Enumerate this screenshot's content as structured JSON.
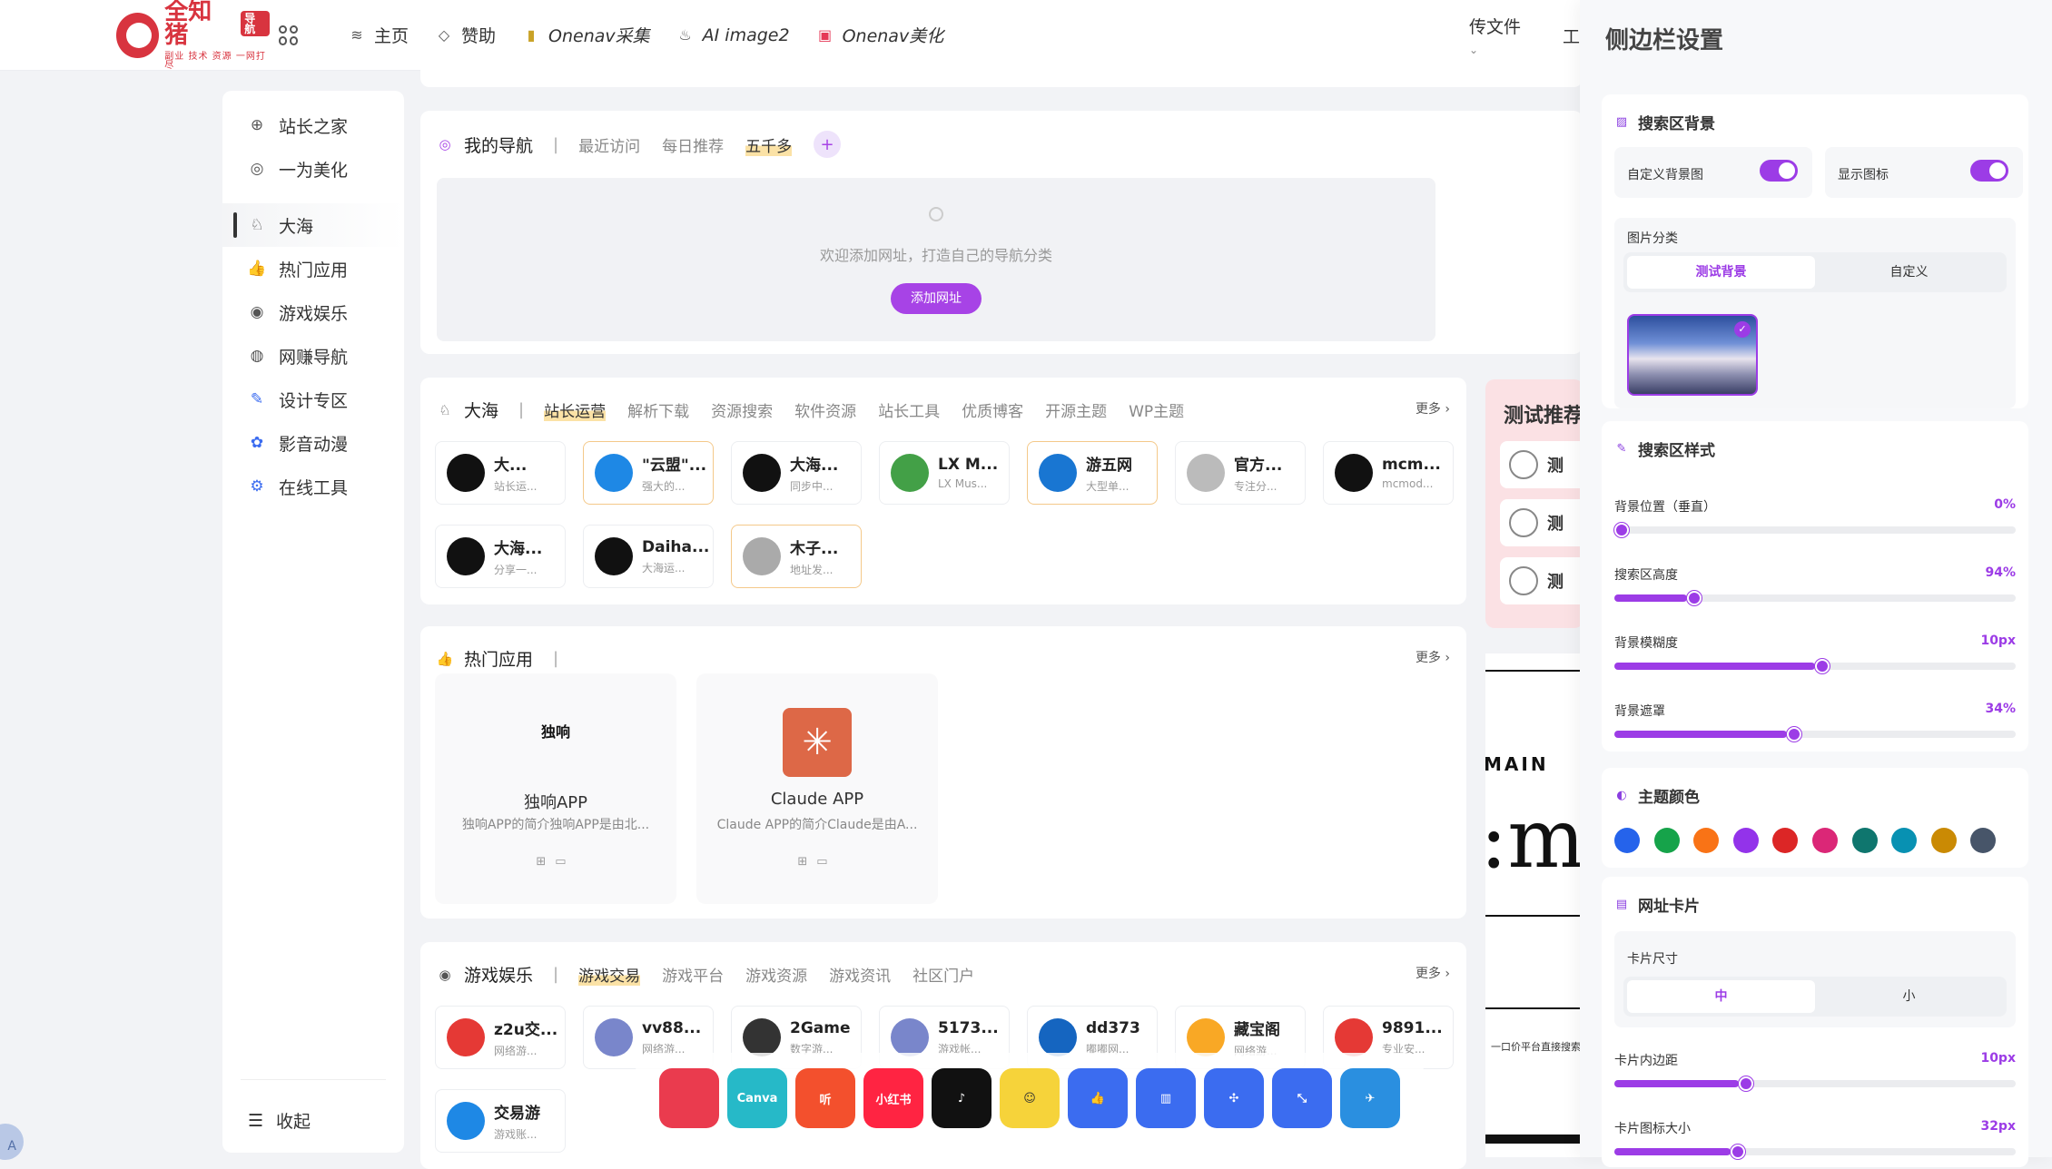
{
  "header": {
    "logo_title": "全知猪",
    "logo_badge": "导航",
    "logo_sub": "副业 技术 资源 一网打尽",
    "nav": [
      {
        "label": "主页",
        "icon": "layers-icon"
      },
      {
        "label": "赞助",
        "icon": "diamond-icon"
      },
      {
        "label": "Onenav采集",
        "icon": "bookmark-icon"
      },
      {
        "label": "AI image2",
        "icon": "flame-icon"
      },
      {
        "label": "Onenav美化",
        "icon": "gift-icon"
      }
    ],
    "upload_label": "传文件",
    "extra_label": "工"
  },
  "sidebar": {
    "items": [
      {
        "label": "站长之家",
        "icon": "plus-circle-icon"
      },
      {
        "label": "一为美化",
        "icon": "at-circle-icon"
      },
      {
        "label": "大海",
        "icon": "rabbit-icon"
      },
      {
        "label": "热门应用",
        "icon": "thumbs-up-icon"
      },
      {
        "label": "游戏娱乐",
        "icon": "gamepad-icon"
      },
      {
        "label": "网赚导航",
        "icon": "money-icon"
      },
      {
        "label": "设计专区",
        "icon": "design-icon"
      },
      {
        "label": "影音动漫",
        "icon": "film-icon"
      },
      {
        "label": "在线工具",
        "icon": "gear-icon"
      }
    ],
    "collapse_label": "收起"
  },
  "my_nav": {
    "title": "我的导航",
    "tabs": [
      "最近访问",
      "每日推荐",
      "五千多"
    ],
    "empty_text": "欢迎添加网址，打造自己的导航分类",
    "add_button": "添加网址"
  },
  "dahai": {
    "title": "大海",
    "tabs": [
      "站长运营",
      "解析下载",
      "资源搜索",
      "软件资源",
      "站长工具",
      "优质博客",
      "开源主题",
      "WP主题"
    ],
    "more": "更多",
    "sites": [
      {
        "name": "大...",
        "desc": "站长运...",
        "color": "#111"
      },
      {
        "name": "\"云盟\"...",
        "desc": "强大的...",
        "color": "#1e88e5"
      },
      {
        "name": "大海...",
        "desc": "同步中...",
        "color": "#111"
      },
      {
        "name": "LX M...",
        "desc": "LX Mus...",
        "color": "#43a047"
      },
      {
        "name": "游五网",
        "desc": "大型单...",
        "color": "#1976d2"
      },
      {
        "name": "官方...",
        "desc": "专注分...",
        "color": "#bbb"
      },
      {
        "name": "mcm...",
        "desc": "mcmod...",
        "color": "#111"
      },
      {
        "name": "大海...",
        "desc": "分享一...",
        "color": "#111"
      },
      {
        "name": "Daiha...",
        "desc": "大海运...",
        "color": "#111"
      },
      {
        "name": "木子...",
        "desc": "地址发...",
        "color": "#aaa"
      }
    ]
  },
  "hot_apps": {
    "title": "热门应用",
    "more": "更多",
    "apps": [
      {
        "name": "独响APP",
        "desc": "独响APP的简介独响APP是由北...",
        "icon_text": "独响"
      },
      {
        "name": "Claude APP",
        "desc": "Claude APP的简介Claude是由A...",
        "icon_text": "✳"
      }
    ]
  },
  "games": {
    "title": "游戏娱乐",
    "tabs": [
      "游戏交易",
      "游戏平台",
      "游戏资源",
      "游戏资讯",
      "社区门户"
    ],
    "more": "更多",
    "sites": [
      {
        "name": "z2u交...",
        "desc": "网络游...",
        "color": "#e53935"
      },
      {
        "name": "vv88...",
        "desc": "网络游...",
        "color": "#7986cb"
      },
      {
        "name": "2Game",
        "desc": "数字游...",
        "color": "#333"
      },
      {
        "name": "5173...",
        "desc": "游戏帐...",
        "color": "#7986cb"
      },
      {
        "name": "dd373",
        "desc": "嘟嘟网...",
        "color": "#1565c0"
      },
      {
        "name": "藏宝阁",
        "desc": "网络游...",
        "color": "#f9a825"
      },
      {
        "name": "9891...",
        "desc": "专业安...",
        "color": "#e53935"
      },
      {
        "name": "交易游",
        "desc": "游戏账...",
        "color": "#1e88e5"
      }
    ]
  },
  "promo": {
    "title": "测试推荐",
    "item_label": "测"
  },
  "banner": {
    "word": "MAIN",
    "small_text": "一口价平台直接搜索"
  },
  "dock": [
    {
      "label": "",
      "color": "#ea3b4e",
      "icon": "pocket-icon"
    },
    {
      "label": "Canva",
      "color": "#26b9c8",
      "icon": "canva-icon"
    },
    {
      "label": "听",
      "color": "#f3502d",
      "icon": "listen-icon"
    },
    {
      "label": "小红书",
      "color": "#ff2442",
      "icon": "xiaohongshu-icon"
    },
    {
      "label": "♪",
      "color": "#111",
      "icon": "tiktok-icon"
    },
    {
      "label": "☺",
      "color": "#f6d33a",
      "icon": "sticker-icon"
    },
    {
      "label": "👍",
      "color": "#3b6cf0",
      "icon": "like-icon"
    },
    {
      "label": "▥",
      "color": "#3b6cf0",
      "icon": "chart-icon"
    },
    {
      "label": "✣",
      "color": "#3b6cf0",
      "icon": "pinwheel-icon"
    },
    {
      "label": "⤡",
      "color": "#3b6cf0",
      "icon": "shrink-icon"
    },
    {
      "label": "✈",
      "color": "#2a8fe0",
      "icon": "telegram-icon"
    }
  ],
  "panel": {
    "title": "侧边栏设置",
    "search_bg": {
      "title": "搜索区背景",
      "custom_bg_label": "自定义背景图",
      "custom_bg_on": true,
      "show_icon_label": "显示图标",
      "show_icon_on": true,
      "category_label": "图片分类",
      "category_options": [
        "测试背景",
        "自定义"
      ],
      "category_selected": "测试背景"
    },
    "search_style": {
      "title": "搜索区样式",
      "sliders": [
        {
          "label": "背景位置（垂直）",
          "value": "0%",
          "fraction": 0.0
        },
        {
          "label": "搜索区高度",
          "value": "94%",
          "fraction": 0.18
        },
        {
          "label": "背景模糊度",
          "value": "10px",
          "fraction": 0.5
        },
        {
          "label": "背景遮罩",
          "value": "34%",
          "fraction": 0.43
        }
      ]
    },
    "theme_color": {
      "title": "主题颜色",
      "colors": [
        "#2563eb",
        "#16a34a",
        "#f97316",
        "#9333ea",
        "#dc2626",
        "#db2777",
        "#0f766e",
        "#0891b2",
        "#ca8a04",
        "#475569"
      ]
    },
    "url_card": {
      "title": "网址卡片",
      "size_label": "卡片尺寸",
      "size_options": [
        "中",
        "小"
      ],
      "size_selected": "中",
      "sliders": [
        {
          "label": "卡片内边距",
          "value": "10px",
          "fraction": 0.31
        },
        {
          "label": "卡片图标大小",
          "value": "32px",
          "fraction": 0.29
        }
      ]
    }
  }
}
